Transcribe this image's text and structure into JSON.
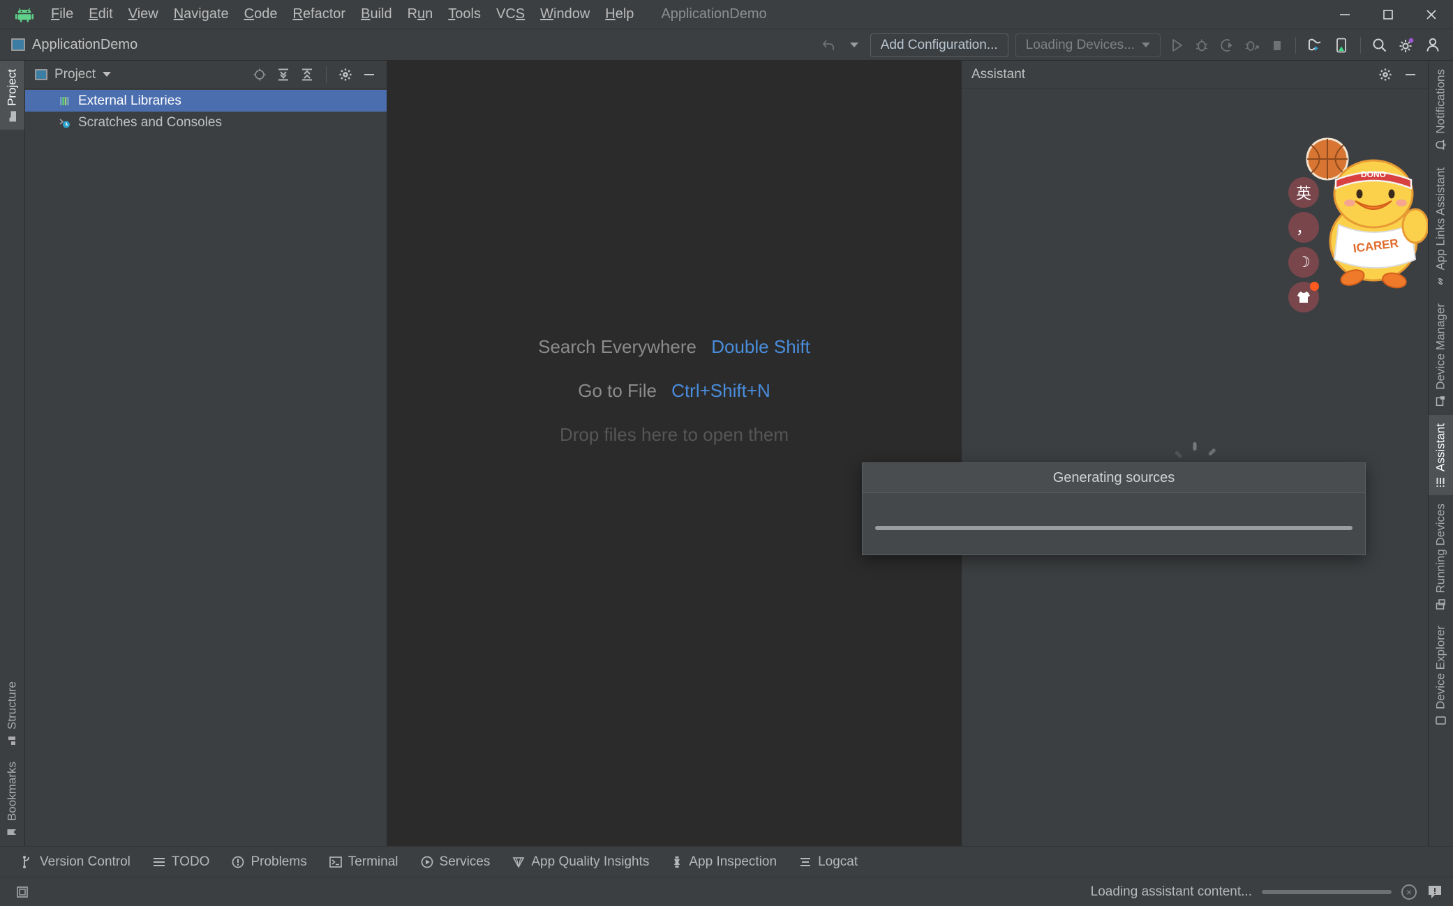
{
  "window": {
    "title": "ApplicationDemo",
    "controls": {
      "minimize": "minimize-button",
      "maximize": "maximize-button",
      "close": "close-button"
    }
  },
  "menubar": {
    "items": [
      {
        "label": "File",
        "mnemonic": "F"
      },
      {
        "label": "Edit",
        "mnemonic": "E"
      },
      {
        "label": "View",
        "mnemonic": "V"
      },
      {
        "label": "Navigate",
        "mnemonic": "N"
      },
      {
        "label": "Code",
        "mnemonic": "C"
      },
      {
        "label": "Refactor",
        "mnemonic": "R"
      },
      {
        "label": "Build",
        "mnemonic": "B"
      },
      {
        "label": "Run",
        "mnemonic": "u"
      },
      {
        "label": "Tools",
        "mnemonic": "T"
      },
      {
        "label": "VCS",
        "mnemonic": "S"
      },
      {
        "label": "Window",
        "mnemonic": "W"
      },
      {
        "label": "Help",
        "mnemonic": "H"
      }
    ]
  },
  "toolbar": {
    "project_name": "ApplicationDemo",
    "add_configuration_label": "Add Configuration...",
    "device_selector_label": "Loading Devices...",
    "run_tooltip": "Run",
    "debug_tooltip": "Debug",
    "run_coverage_tooltip": "Run with Coverage",
    "profile_tooltip": "Profile",
    "stop_tooltip": "Stop",
    "device_file_explorer_tooltip": "Device Manager",
    "sdk_tooltip": "SDK Manager",
    "search_tooltip": "Search Everywhere",
    "settings_tooltip": "Settings",
    "account_tooltip": "Account"
  },
  "left_rail": {
    "top": [
      {
        "label": "Project",
        "icon": "folder-icon",
        "active": true
      }
    ],
    "bottom": [
      {
        "label": "Structure",
        "icon": "structure-icon",
        "active": false
      },
      {
        "label": "Bookmarks",
        "icon": "bookmark-icon",
        "active": false
      }
    ]
  },
  "project_panel": {
    "title": "Project",
    "actions": [
      "locate-icon",
      "expand-all-icon",
      "collapse-all-icon",
      "gear-icon",
      "hide-icon"
    ],
    "tree": [
      {
        "label": "External Libraries",
        "icon": "libraries-icon",
        "selected": true
      },
      {
        "label": "Scratches and Consoles",
        "icon": "scratches-icon",
        "selected": false
      }
    ]
  },
  "editor": {
    "tips": [
      {
        "label": "Search Everywhere",
        "key": "Double Shift"
      },
      {
        "label": "Go to File",
        "key": "Ctrl+Shift+N"
      }
    ],
    "drop_hint": "Drop files here to open them"
  },
  "modal": {
    "title": "Generating sources",
    "progress_indeterminate": true
  },
  "assistant_panel": {
    "title": "Assistant",
    "actions": [
      "gear-icon",
      "hide-icon"
    ],
    "loading_text": "Loading assistant content"
  },
  "right_rail": {
    "items": [
      {
        "label": "Notifications",
        "icon": "bell-icon",
        "active": false
      },
      {
        "label": "App Links Assistant",
        "icon": "link-icon",
        "active": false
      },
      {
        "label": "Device Manager",
        "icon": "device-manager-icon",
        "active": false
      },
      {
        "label": "Assistant",
        "icon": "assistant-icon",
        "active": true
      },
      {
        "label": "Running Devices",
        "icon": "running-devices-icon",
        "active": false
      },
      {
        "label": "Device Explorer",
        "icon": "device-explorer-icon",
        "active": false
      }
    ]
  },
  "bottom_bar": {
    "items": [
      {
        "label": "Version Control",
        "icon": "branch-icon"
      },
      {
        "label": "TODO",
        "icon": "list-icon"
      },
      {
        "label": "Problems",
        "icon": "problem-icon"
      },
      {
        "label": "Terminal",
        "icon": "terminal-icon"
      },
      {
        "label": "Services",
        "icon": "services-icon"
      },
      {
        "label": "App Quality Insights",
        "icon": "diamond-icon"
      },
      {
        "label": "App Inspection",
        "icon": "inspection-icon"
      },
      {
        "label": "Logcat",
        "icon": "logcat-icon"
      }
    ]
  },
  "status_bar": {
    "layout_icon": "layout-icon",
    "task_text": "Loading assistant content...",
    "cancel_label": "×",
    "notification_icon": "event-log-icon"
  },
  "ime_widget": {
    "mascot_text": "ICARER",
    "headband_text": "DONO",
    "buttons": [
      {
        "label": "英",
        "name": "ime-language-button",
        "badge": false
      },
      {
        "label": "，",
        "name": "ime-punctuation-button",
        "badge": false
      },
      {
        "label": "☽",
        "name": "ime-night-mode-button",
        "badge": false
      },
      {
        "label": "👕",
        "name": "ime-skin-button",
        "badge": true
      }
    ]
  },
  "colors": {
    "bg": "#3c3f41",
    "editor_bg": "#2b2b2b",
    "selection": "#4b6eaf",
    "accent_link": "#4a8ddc",
    "text": "#bfc1c2",
    "muted": "#8a8d8f",
    "android_green": "#3ddc84",
    "mascot_yellow": "#fbd14b",
    "ime_button": "#79464c"
  }
}
